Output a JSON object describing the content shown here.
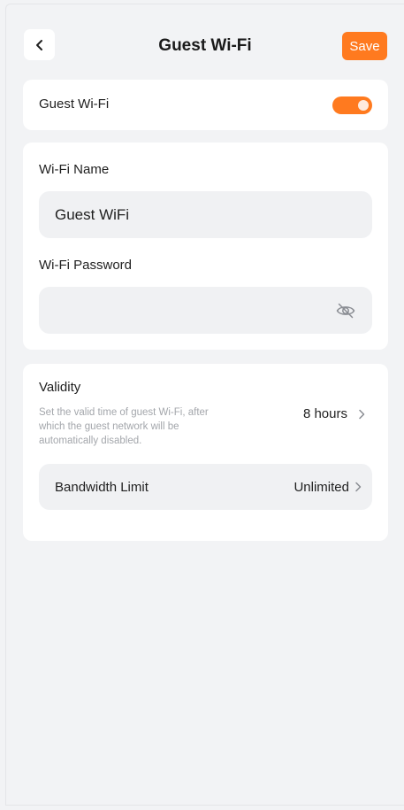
{
  "header": {
    "title": "Guest Wi-Fi",
    "save_label": "Save",
    "back_icon": "chevron-left-icon"
  },
  "guest_wifi": {
    "label": "Guest Wi-Fi",
    "enabled": true,
    "accent_color": "#ff7a1f"
  },
  "wifi": {
    "name_label": "Wi-Fi Name",
    "name_value": "Guest WiFi",
    "password_label": "Wi-Fi Password",
    "password_value": "",
    "password_icon": "eye-off-icon"
  },
  "validity": {
    "title": "Validity",
    "description": "Set the valid time of guest Wi-Fi, after which the guest network will be automatically disabled.",
    "value": "8 hours",
    "chevron_icon": "chevron-right-icon"
  },
  "bandwidth": {
    "label": "Bandwidth Limit",
    "value": "Unlimited",
    "chevron_icon": "chevron-right-icon"
  }
}
